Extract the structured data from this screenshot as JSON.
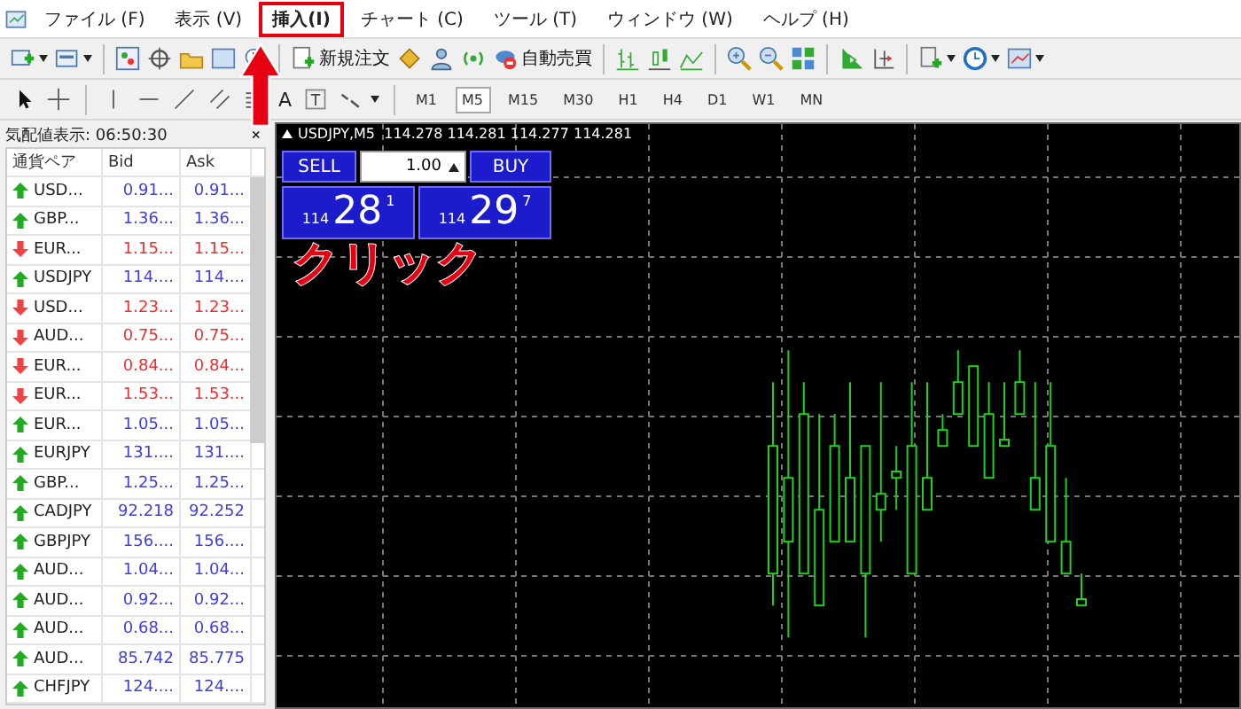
{
  "menu": [
    {
      "label": "ファイル (F)",
      "highlighted": false
    },
    {
      "label": "表示 (V)",
      "highlighted": false
    },
    {
      "label": "挿入(I)",
      "highlighted": true
    },
    {
      "label": "チャート (C)",
      "highlighted": false
    },
    {
      "label": "ツール (T)",
      "highlighted": false
    },
    {
      "label": "ウィンドウ (W)",
      "highlighted": false
    },
    {
      "label": "ヘルプ (H)",
      "highlighted": false
    }
  ],
  "toolbar": {
    "new_order_button": "新規注文",
    "auto_trading_button": "自動売買"
  },
  "drawing_tools": {
    "text_tool": "A"
  },
  "timeframes": [
    {
      "label": "M1",
      "selected": false
    },
    {
      "label": "M5",
      "selected": true
    },
    {
      "label": "M15",
      "selected": false
    },
    {
      "label": "M30",
      "selected": false
    },
    {
      "label": "H1",
      "selected": false
    },
    {
      "label": "H4",
      "selected": false
    },
    {
      "label": "D1",
      "selected": false
    },
    {
      "label": "W1",
      "selected": false
    },
    {
      "label": "MN",
      "selected": false
    }
  ],
  "market_watch": {
    "title": "気配値表示: 06:50:30",
    "close": "×",
    "columns": [
      "通貨ペア",
      "Bid",
      "Ask"
    ],
    "rows": [
      {
        "symbol": "USD...",
        "rising": true,
        "bid": "0.91...",
        "ask": "0.91..."
      },
      {
        "symbol": "GBP...",
        "rising": true,
        "bid": "1.36...",
        "ask": "1.36..."
      },
      {
        "symbol": "EUR...",
        "rising": false,
        "bid": "1.15...",
        "ask": "1.15..."
      },
      {
        "symbol": "USDJPY",
        "rising": true,
        "bid": "114....",
        "ask": "114...."
      },
      {
        "symbol": "USD...",
        "rising": false,
        "bid": "1.23...",
        "ask": "1.23..."
      },
      {
        "symbol": "AUD...",
        "rising": false,
        "bid": "0.75...",
        "ask": "0.75..."
      },
      {
        "symbol": "EUR...",
        "rising": false,
        "bid": "0.84...",
        "ask": "0.84..."
      },
      {
        "symbol": "EUR...",
        "rising": false,
        "bid": "1.53...",
        "ask": "1.53..."
      },
      {
        "symbol": "EUR...",
        "rising": true,
        "bid": "1.05...",
        "ask": "1.05..."
      },
      {
        "symbol": "EURJPY",
        "rising": true,
        "bid": "131....",
        "ask": "131...."
      },
      {
        "symbol": "GBP...",
        "rising": true,
        "bid": "1.25...",
        "ask": "1.25..."
      },
      {
        "symbol": "CADJPY",
        "rising": true,
        "bid": "92.218",
        "ask": "92.252"
      },
      {
        "symbol": "GBPJPY",
        "rising": true,
        "bid": "156....",
        "ask": "156...."
      },
      {
        "symbol": "AUD...",
        "rising": true,
        "bid": "1.04...",
        "ask": "1.04..."
      },
      {
        "symbol": "AUD...",
        "rising": true,
        "bid": "0.92...",
        "ask": "0.92..."
      },
      {
        "symbol": "AUD...",
        "rising": true,
        "bid": "0.68...",
        "ask": "0.68..."
      },
      {
        "symbol": "AUD...",
        "rising": true,
        "bid": "85.742",
        "ask": "85.775"
      },
      {
        "symbol": "CHFJPY",
        "rising": true,
        "bid": "124....",
        "ask": "124...."
      }
    ]
  },
  "chart": {
    "header": "USDJPY,M5  114.278 114.281 114.277 114.281",
    "trade_panel": {
      "sell_button": "SELL",
      "lot": "1.00",
      "buy_button": "BUY",
      "sell_price": {
        "big": "114",
        "main": "28",
        "small": "1"
      },
      "buy_price": {
        "big": "114",
        "main": "29",
        "small": "7"
      }
    }
  },
  "annotation": {
    "label": "クリック"
  }
}
